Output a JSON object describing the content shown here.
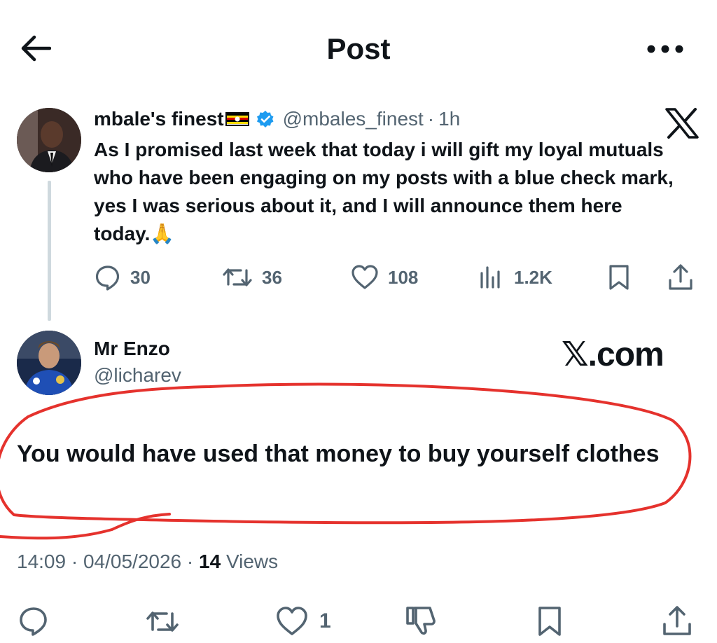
{
  "header": {
    "title": "Post"
  },
  "tweet": {
    "display_name": "mbale's finest",
    "handle": "@mbales_finest",
    "separator": "·",
    "time": "1h",
    "text": "As I promised last week that today i will gift my loyal mutuals who have been engaging on my posts with a blue check mark, yes I was serious about it, and I will announce them here today.🙏",
    "actions": {
      "replies": "30",
      "reposts": "36",
      "likes": "108",
      "views": "1.2K"
    }
  },
  "reply": {
    "display_name": "Mr Enzo",
    "handle": "@licharev",
    "watermark": "𝕏.com",
    "text": "You would have used that money  to buy yourself clothes",
    "time": "14:09",
    "date": "04/05/2026",
    "separator": "·",
    "views_count": "14",
    "views_label": "Views",
    "actions": {
      "likes": "1"
    }
  },
  "colors": {
    "text": "#0f1419",
    "secondary": "#536471",
    "verified": "#1d9bf0",
    "annotation": "#e5322d",
    "thread_line": "#cfd9de"
  },
  "icons": [
    "back-arrow-icon",
    "more-icon",
    "verified-badge-icon",
    "uganda-flag-icon",
    "x-logo-icon",
    "reply-icon",
    "repost-icon",
    "like-icon",
    "views-icon",
    "bookmark-icon",
    "share-icon",
    "dislike-icon"
  ]
}
